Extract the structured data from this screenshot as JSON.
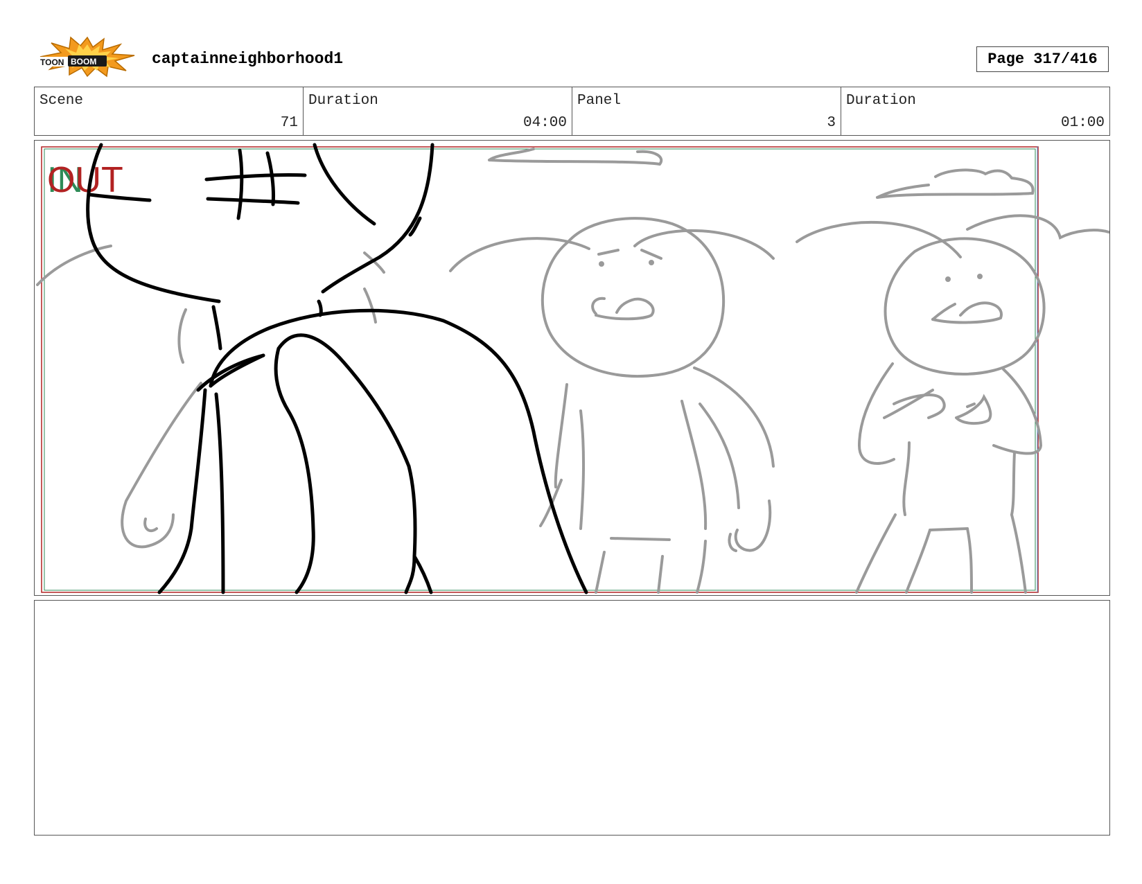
{
  "header": {
    "logo_text": "TOONBOOM",
    "project": "captainneighborhood1",
    "page": "Page 317/416"
  },
  "info": {
    "scene_label": "Scene",
    "scene_value": "71",
    "scene_duration_label": "Duration",
    "scene_duration_value": "04:00",
    "panel_label": "Panel",
    "panel_value": "3",
    "panel_duration_label": "Duration",
    "panel_duration_value": "01:00"
  },
  "panel": {
    "in_marker": "IN",
    "out_marker": "OUT"
  },
  "notes": {
    "text": ""
  },
  "colors": {
    "frame_red": "#b22222",
    "frame_green": "#2e8b57",
    "sketch_black": "#000000",
    "sketch_gray": "#9a9a9a",
    "logo_orange": "#f39a1e"
  }
}
